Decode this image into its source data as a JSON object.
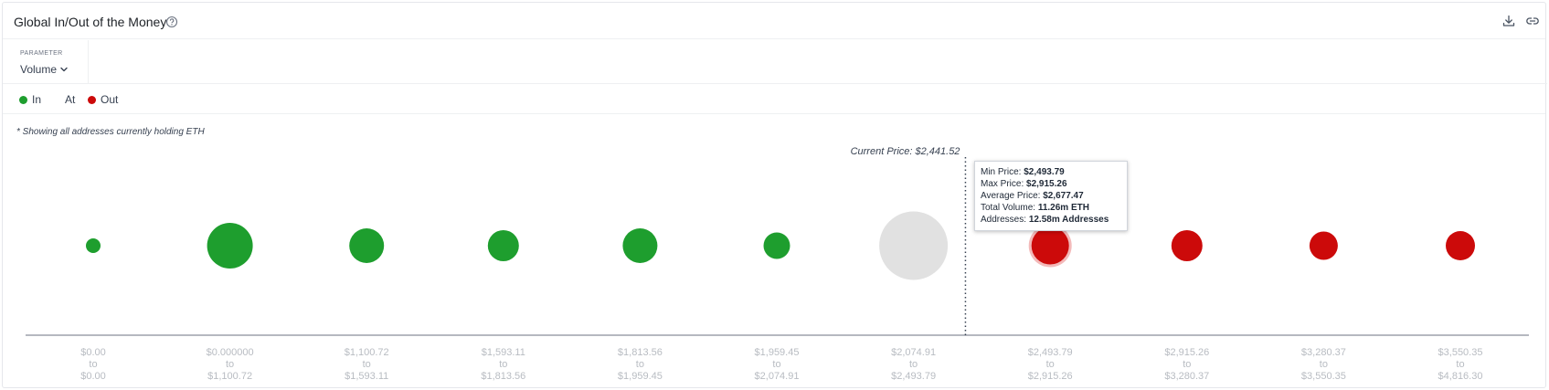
{
  "header": {
    "title": "Global In/Out of the Money"
  },
  "parameter": {
    "label": "PARAMETER",
    "selected": "Volume"
  },
  "legend": {
    "in": "In",
    "at": "At",
    "out": "Out"
  },
  "colors": {
    "in": "#1e9e2e",
    "at": "#e1e1e1",
    "out": "#cc0a0a",
    "axis_label": "#b8bcc2"
  },
  "note": "* Showing all addresses currently holding ETH",
  "tooltip": {
    "min_price_label": "Min Price:",
    "min_price": "$2,493.79",
    "max_price_label": "Max Price:",
    "max_price": "$2,915.26",
    "avg_price_label": "Average Price:",
    "avg_price": "$2,677.47",
    "volume_label": "Total Volume:",
    "volume": "11.26m ETH",
    "addresses_label": "Addresses:",
    "addresses": "12.58m Addresses"
  },
  "chart_data": {
    "type": "bubble",
    "current_price_label": "Current Price: $2,441.52",
    "current_price": 2441.52,
    "ranges": [
      {
        "low": "$0.00",
        "high": "$0.00",
        "status": "in",
        "size": 0.32
      },
      {
        "low": "$0.000000",
        "high": "$1,100.72",
        "status": "in",
        "size": 1.0
      },
      {
        "low": "$1,100.72",
        "high": "$1,593.11",
        "status": "in",
        "size": 0.76
      },
      {
        "low": "$1,593.11",
        "high": "$1,813.56",
        "status": "in",
        "size": 0.68
      },
      {
        "low": "$1,813.56",
        "high": "$1,959.45",
        "status": "in",
        "size": 0.76
      },
      {
        "low": "$1,959.45",
        "high": "$2,074.91",
        "status": "in",
        "size": 0.58
      },
      {
        "low": "$2,074.91",
        "high": "$2,493.79",
        "status": "at",
        "size": 1.5
      },
      {
        "low": "$2,493.79",
        "high": "$2,915.26",
        "status": "out",
        "size": 0.82,
        "highlighted": true
      },
      {
        "low": "$2,915.26",
        "high": "$3,280.37",
        "status": "out",
        "size": 0.68
      },
      {
        "low": "$3,280.37",
        "high": "$3,550.35",
        "status": "out",
        "size": 0.62
      },
      {
        "low": "$3,550.35",
        "high": "$4,816.30",
        "status": "out",
        "size": 0.64
      }
    ],
    "range_separator": "to",
    "current_price_range_index": 6,
    "current_price_fraction": 0.88
  }
}
